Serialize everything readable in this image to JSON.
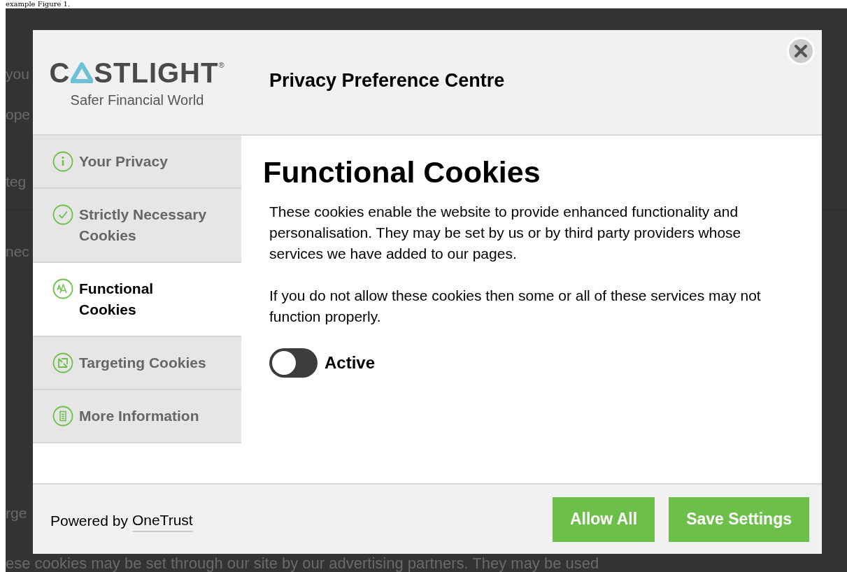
{
  "background": {
    "caption": "example Figure 1.",
    "fragments": [
      "you",
      "ope",
      "teg",
      "nec",
      "rge"
    ],
    "bottom_text": "ese cookies may be set through our site by our advertising partners. They may be used"
  },
  "dialog": {
    "logo": {
      "wordmark_start": "C",
      "wordmark_end": "STLIGHT",
      "registered": "®",
      "tagline": "Safer Financial World"
    },
    "title": "Privacy Preference Centre",
    "nav": [
      {
        "label": "Your Privacy",
        "kind": "info",
        "selected": false
      },
      {
        "label": "Strictly Necessary Cookies",
        "kind": "check",
        "selected": false
      },
      {
        "label": "Functional Cookies",
        "kind": "text",
        "selected": true
      },
      {
        "label": "Targeting Cookies",
        "kind": "target",
        "selected": false
      },
      {
        "label": "More Information",
        "kind": "document",
        "selected": false
      }
    ],
    "content": {
      "heading": "Functional Cookies",
      "paragraphs": [
        "These cookies enable the website to provide enhanced functionality and personalisation. They may be set by us or by third party providers whose services we have added to our pages.",
        "If you do not allow these cookies then some or all of these services may not function properly."
      ],
      "toggle": {
        "label": "Active",
        "on": false
      }
    },
    "footer": {
      "powered_by": "Powered by",
      "link": "OneTrust",
      "buttons": [
        "Allow All",
        "Save Settings"
      ]
    }
  }
}
